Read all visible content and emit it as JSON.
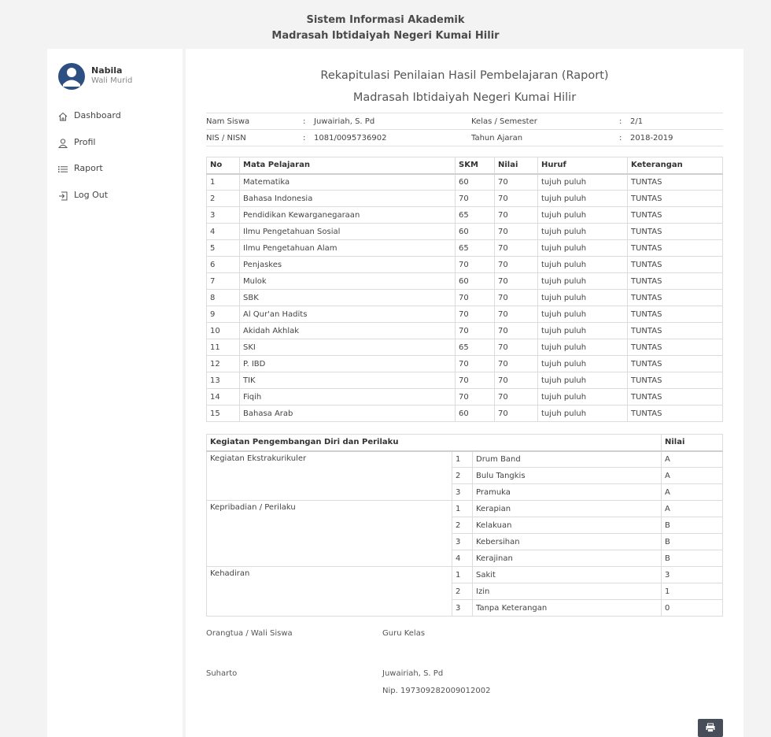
{
  "header": {
    "line1": "Sistem Informasi Akademik",
    "line2": "Madrasah Ibtidaiyah Negeri Kumai Hilir"
  },
  "user": {
    "name": "Nabila",
    "role": "Wali Murid"
  },
  "nav": [
    {
      "label": "Dashboard",
      "icon": "home-icon"
    },
    {
      "label": "Profil",
      "icon": "user-icon"
    },
    {
      "label": "Raport",
      "icon": "list-icon"
    },
    {
      "label": "Log Out",
      "icon": "logout-icon"
    }
  ],
  "report": {
    "title1": "Rekapitulasi Penilaian Hasil Pembelajaran (Raport)",
    "title2": "Madrasah Ibtidaiyah Negeri Kumai Hilir",
    "info": {
      "nama_label": "Nam Siswa",
      "nama_value": "Juwairiah, S. Pd",
      "nis_label": "NIS / NISN",
      "nis_value": "1081/0095736902",
      "kelas_label": "Kelas / Semester",
      "kelas_value": "2/1",
      "tahun_label": "Tahun Ajaran",
      "tahun_value": "2018-2019",
      "sep": ":"
    },
    "grades_headers": [
      "No",
      "Mata Pelajaran",
      "SKM",
      "Nilai",
      "Huruf",
      "Keterangan"
    ],
    "grades": [
      [
        "1",
        "Matematika",
        "60",
        "70",
        "tujuh puluh",
        "TUNTAS"
      ],
      [
        "2",
        "Bahasa Indonesia",
        "70",
        "70",
        "tujuh puluh",
        "TUNTAS"
      ],
      [
        "3",
        "Pendidikan Kewarganegaraan",
        "65",
        "70",
        "tujuh puluh",
        "TUNTAS"
      ],
      [
        "4",
        "Ilmu Pengetahuan Sosial",
        "60",
        "70",
        "tujuh puluh",
        "TUNTAS"
      ],
      [
        "5",
        "Ilmu Pengetahuan Alam",
        "65",
        "70",
        "tujuh puluh",
        "TUNTAS"
      ],
      [
        "6",
        "Penjaskes",
        "70",
        "70",
        "tujuh puluh",
        "TUNTAS"
      ],
      [
        "7",
        "Mulok",
        "60",
        "70",
        "tujuh puluh",
        "TUNTAS"
      ],
      [
        "8",
        "SBK",
        "70",
        "70",
        "tujuh puluh",
        "TUNTAS"
      ],
      [
        "9",
        "Al Qur'an Hadits",
        "70",
        "70",
        "tujuh puluh",
        "TUNTAS"
      ],
      [
        "10",
        "Akidah Akhlak",
        "70",
        "70",
        "tujuh puluh",
        "TUNTAS"
      ],
      [
        "11",
        "SKI",
        "65",
        "70",
        "tujuh puluh",
        "TUNTAS"
      ],
      [
        "12",
        "P. IBD",
        "70",
        "70",
        "tujuh puluh",
        "TUNTAS"
      ],
      [
        "13",
        "TIK",
        "70",
        "70",
        "tujuh puluh",
        "TUNTAS"
      ],
      [
        "14",
        "Fiqih",
        "70",
        "70",
        "tujuh puluh",
        "TUNTAS"
      ],
      [
        "15",
        "Bahasa Arab",
        "60",
        "70",
        "tujuh puluh",
        "TUNTAS"
      ]
    ],
    "dev_header": "Kegiatan Pengembangan Diri dan Perilaku",
    "dev_nilai_header": "Nilai",
    "dev_groups": [
      {
        "title": "Kegiatan Ekstrakurikuler",
        "rows": [
          [
            "1",
            "Drum Band",
            "A"
          ],
          [
            "2",
            "Bulu Tangkis",
            "A"
          ],
          [
            "3",
            "Pramuka",
            "A"
          ]
        ]
      },
      {
        "title": "Kepribadian / Perilaku",
        "rows": [
          [
            "1",
            "Kerapian",
            "A"
          ],
          [
            "2",
            "Kelakuan",
            "B"
          ],
          [
            "3",
            "Kebersihan",
            "B"
          ],
          [
            "4",
            "Kerajinan",
            "B"
          ]
        ]
      },
      {
        "title": "Kehadiran",
        "rows": [
          [
            "1",
            "Sakit",
            "3"
          ],
          [
            "2",
            "Izin",
            "1"
          ],
          [
            "3",
            "Tanpa Keterangan",
            "0"
          ]
        ]
      }
    ],
    "signature": {
      "parent_label": "Orangtua / Wali Siswa",
      "parent_name": "Suharto",
      "teacher_label": "Guru Kelas",
      "teacher_name": "Juwairiah, S. Pd",
      "teacher_nip": "Nip. 197309282009012002"
    }
  },
  "colors": {
    "avatar": "#2d4f82",
    "print_button": "#474e59"
  }
}
